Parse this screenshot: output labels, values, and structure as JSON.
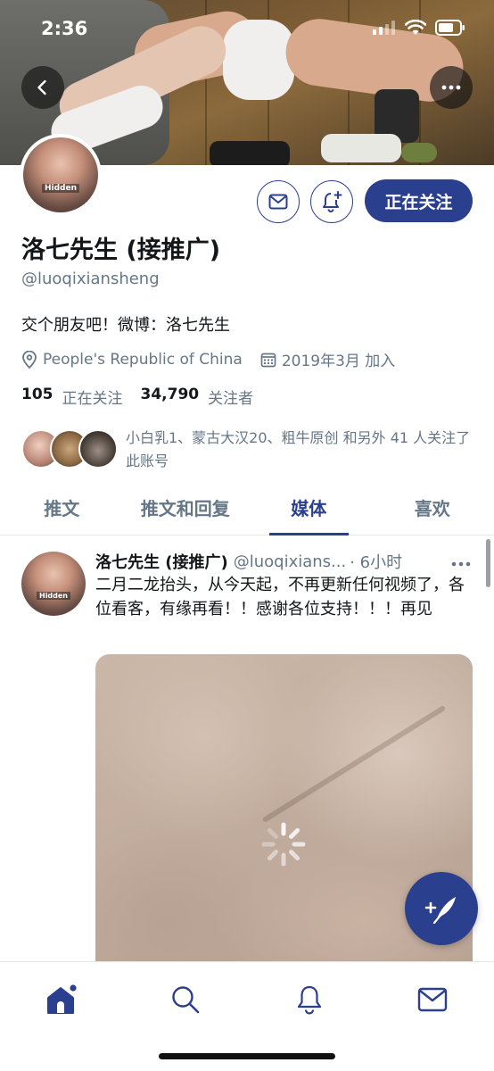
{
  "status_bar": {
    "time": "2:36"
  },
  "profile": {
    "display_name": "洛七先生 (接推广)",
    "handle": "@luoqixiansheng",
    "bio": "交个朋友吧！微博：洛七先生",
    "location": "People's Republic of China",
    "joined": "2019年3月 加入",
    "following_count": "105",
    "following_label": "正在关注",
    "followers_count": "34,790",
    "followers_label": "关注者",
    "followed_by_text": "小白乳1、蒙古大汉20、粗牛原创 和另外 41 人关注了此账号",
    "follow_button_label": "正在关注",
    "avatar_overlay_text": "Hidden"
  },
  "tabs": [
    {
      "label": "推文",
      "active": false
    },
    {
      "label": "推文和回复",
      "active": false
    },
    {
      "label": "媒体",
      "active": true
    },
    {
      "label": "喜欢",
      "active": false
    }
  ],
  "tweet": {
    "author_name": "洛七先生 (接推广)",
    "author_handle": "@luoqixians...",
    "time": "· 6小时",
    "text": "二月二龙抬头，从今天起，不再更新任何视频了，各位看客，有缘再看！！感谢各位支持！！！再见"
  },
  "icons": {
    "back": "chevron-left-icon",
    "more": "more-horizontal-icon",
    "mail": "mail-icon",
    "notify": "bell-plus-icon",
    "location": "location-pin-icon",
    "calendar": "calendar-icon",
    "compose": "feather-plus-icon",
    "nav": [
      "home-icon",
      "search-icon",
      "bell-icon",
      "mail-icon"
    ]
  },
  "colors": {
    "accent": "#2b3f8f",
    "secondary_text": "#657786",
    "primary_text": "#14171a"
  }
}
